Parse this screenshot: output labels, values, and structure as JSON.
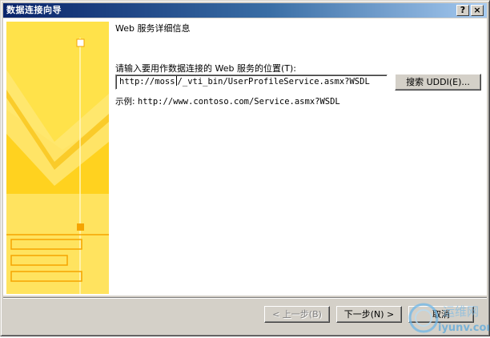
{
  "window": {
    "title": "数据连接向导",
    "help_label": "?",
    "close_label": "×"
  },
  "page": {
    "subtitle": "Web 服务详细信息",
    "location_label": "请输入要用作数据连接的 Web 服务的位置(T):",
    "url_before_caret": "http://moss",
    "url_after_caret": "/_vti_bin/UserProfileService.asmx?WSDL",
    "search_label": "搜索 UDDI(E)...",
    "example_prefix": "示例:",
    "example_url": "http://www.contoso.com/Service.asmx?WSDL"
  },
  "footer": {
    "back_label": "< 上一步(B)",
    "next_label": "下一步(N) >",
    "cancel_label": "取消"
  },
  "watermark": {
    "cn_text": "运维网",
    "site_text": "iyunv.com"
  },
  "colors": {
    "title_gradient_start": "#0a246a",
    "title_gradient_end": "#a6caf0",
    "dialog_face": "#d4d0c8",
    "art_yellow": "#ffd21f",
    "art_light": "#ffe873",
    "art_orange": "#f5a400"
  }
}
